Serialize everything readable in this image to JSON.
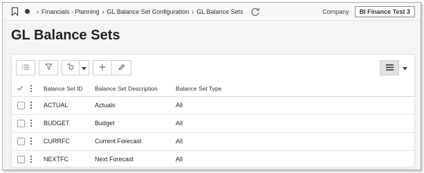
{
  "breadcrumb": {
    "items": [
      "Financials - Planning",
      "GL Balance Set Configuration",
      "GL Balance Sets"
    ]
  },
  "company": {
    "label": "Company",
    "value": "BI Finance Test 3"
  },
  "page": {
    "title": "GL Balance Sets"
  },
  "table": {
    "headers": [
      "Balance Set ID",
      "Balance Set Description",
      "Balance Set Type"
    ],
    "rows": [
      {
        "id": "ACTUAL",
        "description": "Actuals",
        "type": "All"
      },
      {
        "id": "BUDGET",
        "description": "Budget",
        "type": "All"
      },
      {
        "id": "CURRFC",
        "description": "Current Forecast",
        "type": "All"
      },
      {
        "id": "NEXTFC",
        "description": "Next Forecast",
        "type": "All"
      }
    ]
  },
  "icons": {
    "bookmark": "bookmark-icon",
    "refresh": "refresh-icon",
    "list": "list-icon",
    "filter": "filter-icon",
    "navigate": "navigate-icon",
    "add": "plus-icon",
    "edit": "pencil-icon",
    "view": "table-view-icon"
  }
}
